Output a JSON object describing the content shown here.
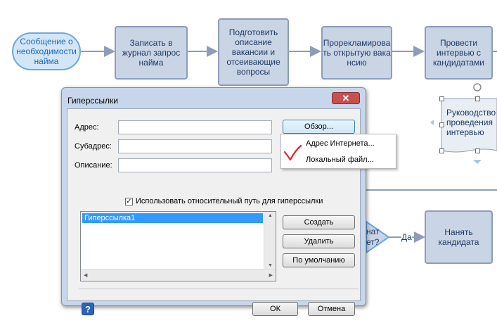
{
  "flowchart": {
    "start_node": "Сообщение о необходимости найма",
    "step1": "Записать в журнал запрос найма",
    "step2": "Подготовить описание вакансии и отсеивающие вопросы",
    "step3": "Прорекламировать открытую вакансию",
    "step4": "Провести интервью с кандидатами",
    "doc_node": "Руководство проведения интервью",
    "decision_partial": "?",
    "decision_fragment1": "нат",
    "decision_fragment2": "ет?",
    "yes_label": "Да",
    "hire_node": "Нанять кандидата",
    "colors": {
      "process_fill": "#c9d4e5",
      "process_border": "#8d9db9",
      "start_fill": "#d3e6f7",
      "start_border": "#6fa8dc",
      "text": "#1f3a62"
    }
  },
  "dialog": {
    "title": "Гиперссылки",
    "close_glyph": "✕",
    "address_label": "Адрес:",
    "address_value": "",
    "subaddress_label": "Субадрес:",
    "subaddress_value": "",
    "description_label": "Описание:",
    "description_value": "",
    "browse_button": "Обзор...",
    "relative_path_checkbox": {
      "label": "Использовать относительный путь для гиперссылки",
      "checked": true
    },
    "hyperlinks_list": [
      "Гиперссылка1"
    ],
    "create_button": "Создать",
    "delete_button": "Удалить",
    "default_button": "По умолчанию",
    "ok_button": "ОК",
    "cancel_button": "Отмена",
    "help_icon": "?"
  },
  "browse_menu": {
    "items": [
      "Адрес Интернета...",
      "Локальный файл..."
    ],
    "accent_mark_color": "#e0262b"
  }
}
